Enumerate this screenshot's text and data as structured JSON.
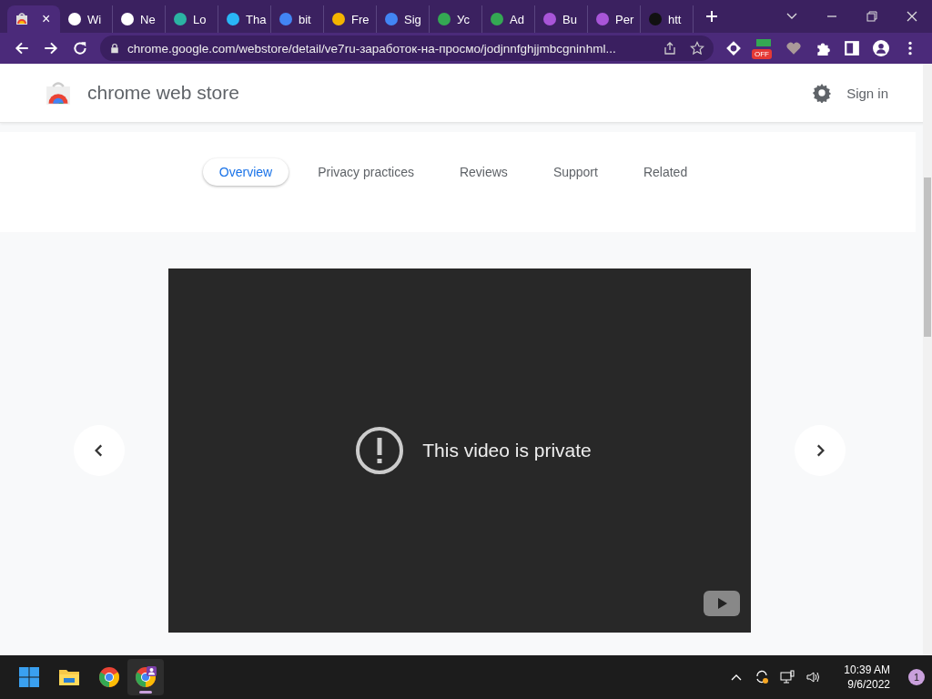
{
  "tabs": [
    {
      "selected": true,
      "close": "×"
    },
    {
      "title": "Wi",
      "selected": false
    },
    {
      "title": "Ne",
      "selected": false
    },
    {
      "title": "Lo",
      "selected": false
    },
    {
      "title": "Tha",
      "selected": false
    },
    {
      "title": "bit",
      "selected": false
    },
    {
      "title": "Fre",
      "selected": false
    },
    {
      "title": "Sig",
      "selected": false
    },
    {
      "title": "Ус",
      "selected": false
    },
    {
      "title": "Ad",
      "selected": false
    },
    {
      "title": "Bu",
      "selected": false
    },
    {
      "title": "Per",
      "selected": false
    },
    {
      "title": "htt",
      "selected": false
    }
  ],
  "address_bar": {
    "url": "chrome.google.com/webstore/detail/ve7ru-заработок-на-просмо/jodjnnfghjjmbcgninhml...",
    "extension_badge": "OFF"
  },
  "header": {
    "title": "chrome web store",
    "sign_in": "Sign in"
  },
  "nav": [
    {
      "label": "Overview",
      "selected": true
    },
    {
      "label": "Privacy practices",
      "selected": false
    },
    {
      "label": "Reviews",
      "selected": false
    },
    {
      "label": "Support",
      "selected": false
    },
    {
      "label": "Related",
      "selected": false
    }
  ],
  "video": {
    "message": "This video is private"
  },
  "taskbar": {
    "time": "10:39 AM",
    "date": "9/6/2022",
    "notifications": "1"
  }
}
